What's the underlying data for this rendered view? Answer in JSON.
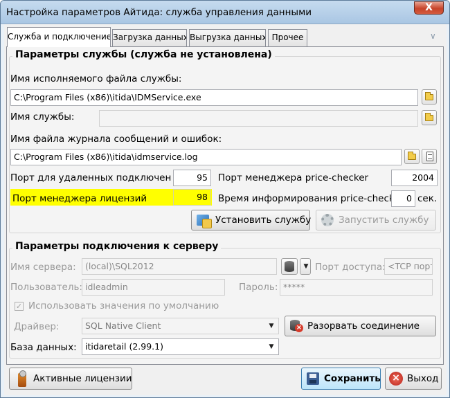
{
  "window": {
    "title": "Настройка параметров Айтида: служба управления данными",
    "close_label": "X"
  },
  "tabs": [
    {
      "label": "Служба и подключение",
      "active": true
    },
    {
      "label": "Загрузка данных",
      "active": false
    },
    {
      "label": "Выгрузка данных",
      "active": false
    },
    {
      "label": "Прочее",
      "active": false
    }
  ],
  "service": {
    "group_title": "Параметры службы (служба не установлена)",
    "exe_label": "Имя исполняемого файла службы:",
    "exe_value": "C:\\Program Files (x86)\\itida\\IDMService.exe",
    "name_label": "Имя службы:",
    "name_value": "",
    "log_label": "Имя файла журнала сообщений и ошибок:",
    "log_value": "C:\\Program Files (x86)\\itida\\idmservice.log",
    "remote_port_label": "Порт для удаленных подключени",
    "remote_port_value": "95",
    "pricechecker_port_label": "Порт менеджера price-checker",
    "pricechecker_port_value": "2004",
    "license_port_label": "Порт менеджера лицензий",
    "license_port_value": "98",
    "inform_time_label": "Время информирования price-check",
    "inform_time_value": "0",
    "inform_time_unit": "сек.",
    "install_button": "Установить службу",
    "start_button": "Запустить службу"
  },
  "server": {
    "group_title": "Параметры подключения к серверу",
    "server_name_label": "Имя сервера:",
    "server_name_value": "(local)\\SQL2012",
    "access_port_label": "Порт доступа:",
    "access_port_value": "<TCP порт",
    "user_label": "Пользователь:",
    "user_value": "idleadmin",
    "password_label": "Пароль:",
    "password_value": "*****",
    "use_defaults_label": "Использовать значения по умолчанию",
    "driver_label": "Драйвер:",
    "driver_value": "SQL Native Client",
    "disconnect_button": "Разорвать соединение",
    "database_label": "База данных:",
    "database_value": "itidaretail (2.99.1)"
  },
  "footer": {
    "licenses_button": "Активные лицензии",
    "save_button": "Сохранить",
    "exit_button": "Выход"
  },
  "colors": {
    "highlight": "#ffff00",
    "accent": "#3c7fb1"
  }
}
